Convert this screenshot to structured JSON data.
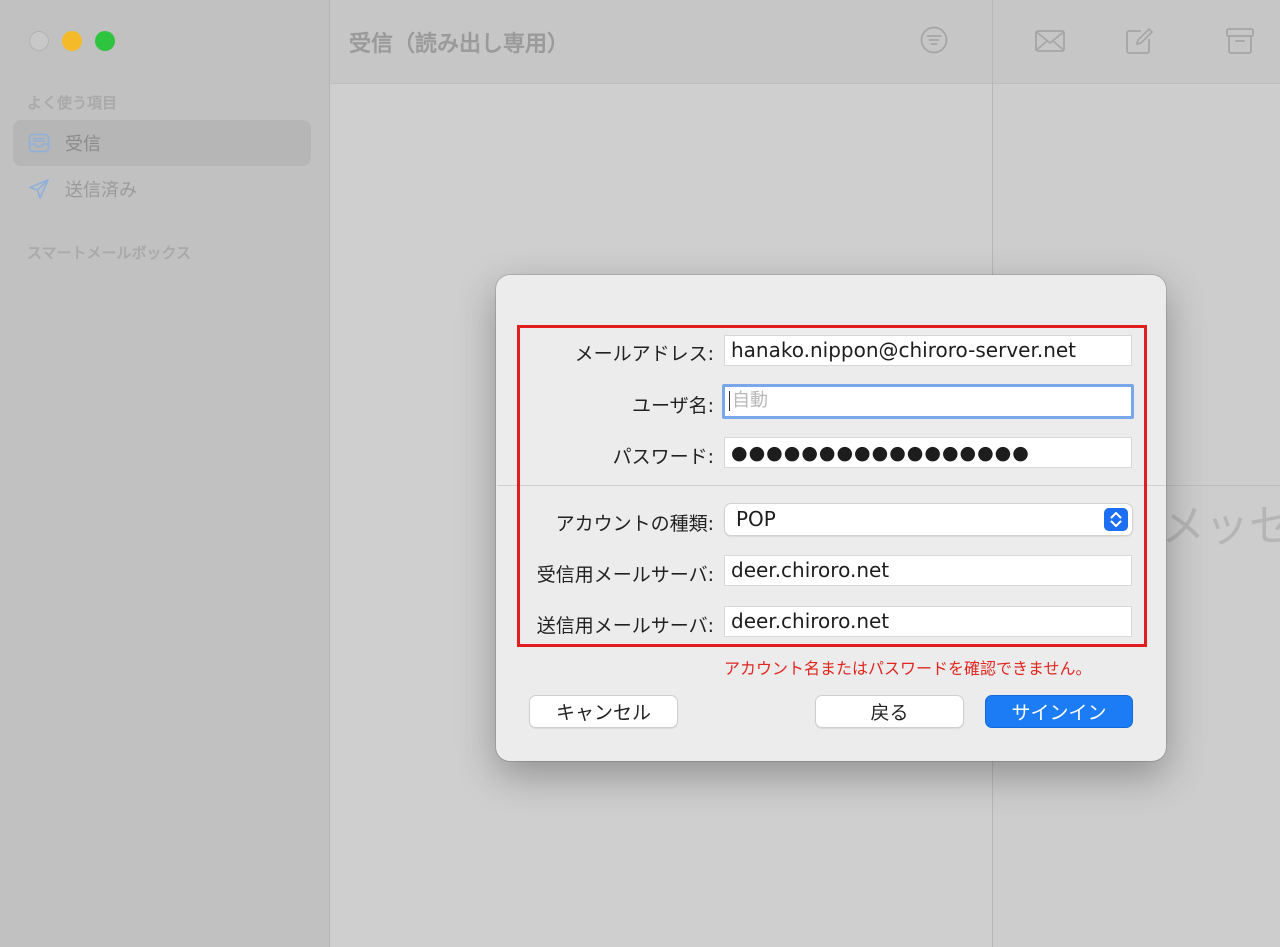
{
  "window": {
    "sidebar": {
      "section_favorites": "よく使う項目",
      "items": [
        {
          "label": "受信",
          "icon": "inbox-icon",
          "selected": true
        },
        {
          "label": "送信済み",
          "icon": "paper-plane-icon",
          "selected": false
        }
      ],
      "section_smart": "スマートメールボックス"
    },
    "list_title": "受信（読み出し専用）",
    "toolbar_icons": [
      "filter-icon",
      "envelope-icon",
      "compose-icon",
      "archive-icon"
    ],
    "detail_placeholder": "メッセ"
  },
  "dialog": {
    "email_label": "メールアドレス:",
    "email_value": "hanako.nippon@chiroro-server.net",
    "username_label": "ユーザ名:",
    "username_placeholder": "自動",
    "password_label": "パスワード:",
    "password_value": "●●●●●●●●●●●●●●●●●",
    "account_type_label": "アカウントの種類:",
    "account_type_value": "POP",
    "incoming_label": "受信用メールサーバ:",
    "incoming_value": "deer.chiroro.net",
    "outgoing_label": "送信用メールサーバ:",
    "outgoing_value": "deer.chiroro.net",
    "error_text": "アカウント名またはパスワードを確認できません。",
    "cancel_label": "キャンセル",
    "back_label": "戻る",
    "signin_label": "サインイン"
  },
  "colors": {
    "highlight_box": "#e11d1d",
    "error_text": "#e0261f",
    "primary_button": "#1c7cf5",
    "focus_ring": "#7aa6ea"
  }
}
